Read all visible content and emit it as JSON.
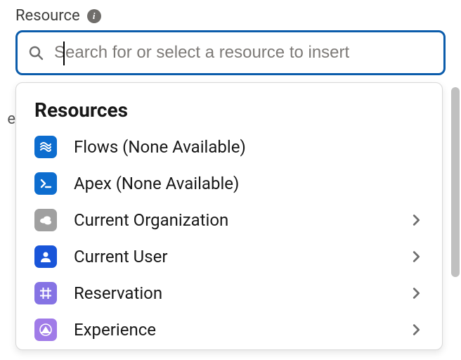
{
  "field": {
    "label": "Resource",
    "placeholder": "Search for or select a resource to insert"
  },
  "dropdown": {
    "title": "Resources",
    "items": [
      {
        "label": "Flows (None Available)",
        "icon": "flow-icon",
        "has_children": false
      },
      {
        "label": "Apex (None Available)",
        "icon": "apex-icon",
        "has_children": false
      },
      {
        "label": "Current Organization",
        "icon": "org-icon",
        "has_children": true
      },
      {
        "label": "Current User",
        "icon": "user-icon",
        "has_children": true
      },
      {
        "label": "Reservation",
        "icon": "reservation-icon",
        "has_children": true
      },
      {
        "label": "Experience",
        "icon": "experience-icon",
        "has_children": true
      }
    ]
  },
  "background_fragment": "e"
}
